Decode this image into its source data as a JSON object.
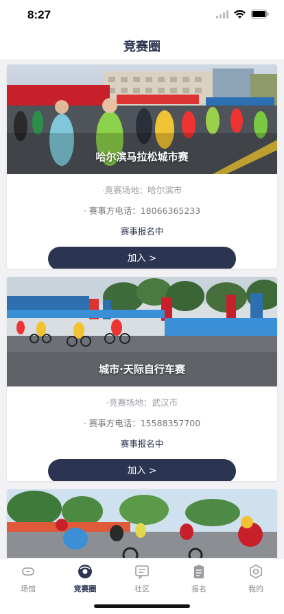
{
  "status_bar": {
    "time": "8:27"
  },
  "nav": {
    "title": "竞赛圈"
  },
  "cards": [
    {
      "title": "哈尔滨马拉松城市赛",
      "venue": "·竞赛场地：哈尔滨市",
      "phone": "· 赛事方电话：18066365233",
      "status": "赛事报名中",
      "button": "加入 >"
    },
    {
      "title": "城市·天际自行车赛",
      "venue": "·竞赛场地：武汉市",
      "phone": "· 赛事方电话：15588357700",
      "status": "赛事报名中",
      "button": "加入 >"
    }
  ],
  "tabs": [
    {
      "label": "场馆",
      "icon": "venue-icon"
    },
    {
      "label": "竞赛圈",
      "icon": "competition-icon"
    },
    {
      "label": "社区",
      "icon": "community-icon"
    },
    {
      "label": "报名",
      "icon": "signup-icon"
    },
    {
      "label": "我的",
      "icon": "settings-icon"
    }
  ],
  "colors": {
    "primary": "#2b3450",
    "tab_inactive": "#8a8a8f",
    "background": "#f2f2f4"
  }
}
